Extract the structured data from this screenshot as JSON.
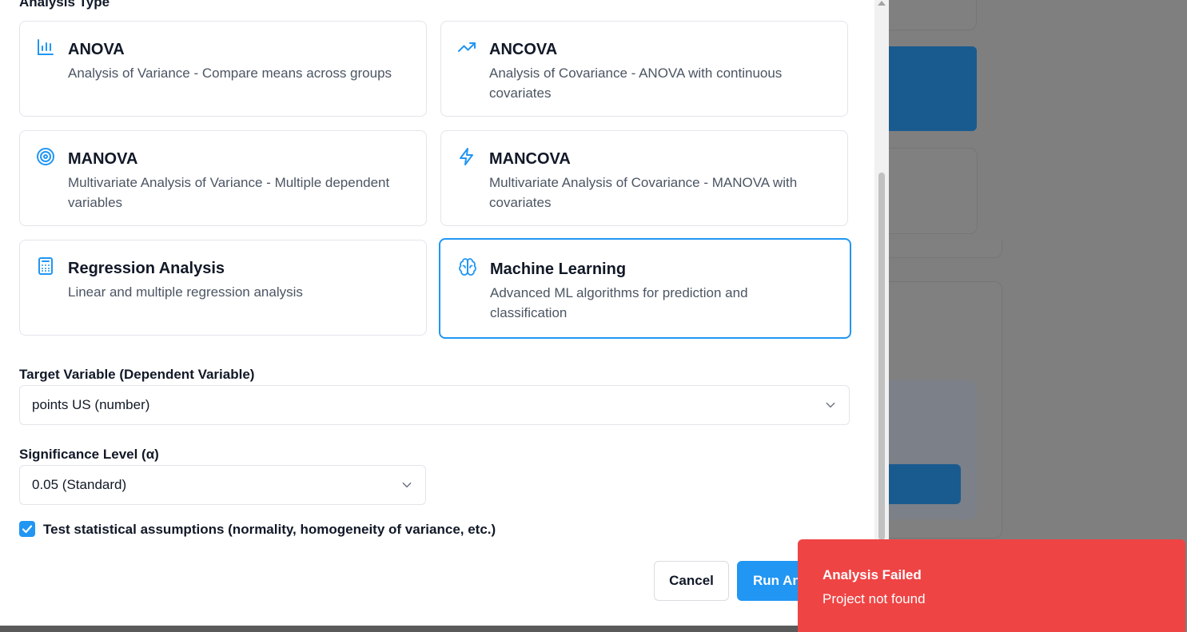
{
  "analysis": {
    "section_title": "Analysis Type",
    "cards": [
      {
        "title": "ANOVA",
        "description": "Analysis of Variance - Compare means across groups",
        "icon": "bar-chart-icon"
      },
      {
        "title": "ANCOVA",
        "description": "Analysis of Covariance - ANOVA with continuous covariates",
        "icon": "trending-up-icon"
      },
      {
        "title": "MANOVA",
        "description": "Multivariate Analysis of Variance - Multiple dependent variables",
        "icon": "target-icon"
      },
      {
        "title": "MANCOVA",
        "description": "Multivariate Analysis of Covariance - MANOVA with covariates",
        "icon": "lightning-icon"
      },
      {
        "title": "Regression Analysis",
        "description": "Linear and multiple regression analysis",
        "icon": "calculator-icon"
      },
      {
        "title": "Machine Learning",
        "description": "Advanced ML algorithms for prediction and classification",
        "icon": "brain-icon",
        "selected": true
      }
    ]
  },
  "target_variable": {
    "label": "Target Variable (Dependent Variable)",
    "value": "points US (number)"
  },
  "significance": {
    "label": "Significance Level (α)",
    "value": "0.05 (Standard)"
  },
  "assumptions": {
    "label": "Test statistical assumptions (normality, homogeneity of variance, etc.)",
    "checked": true
  },
  "buttons": {
    "cancel": "Cancel",
    "run": "Run Analysis"
  },
  "toast": {
    "title": "Analysis Failed",
    "description": "Project not found"
  },
  "colors": {
    "accent": "#2196f3",
    "toast": "#ef4444"
  }
}
